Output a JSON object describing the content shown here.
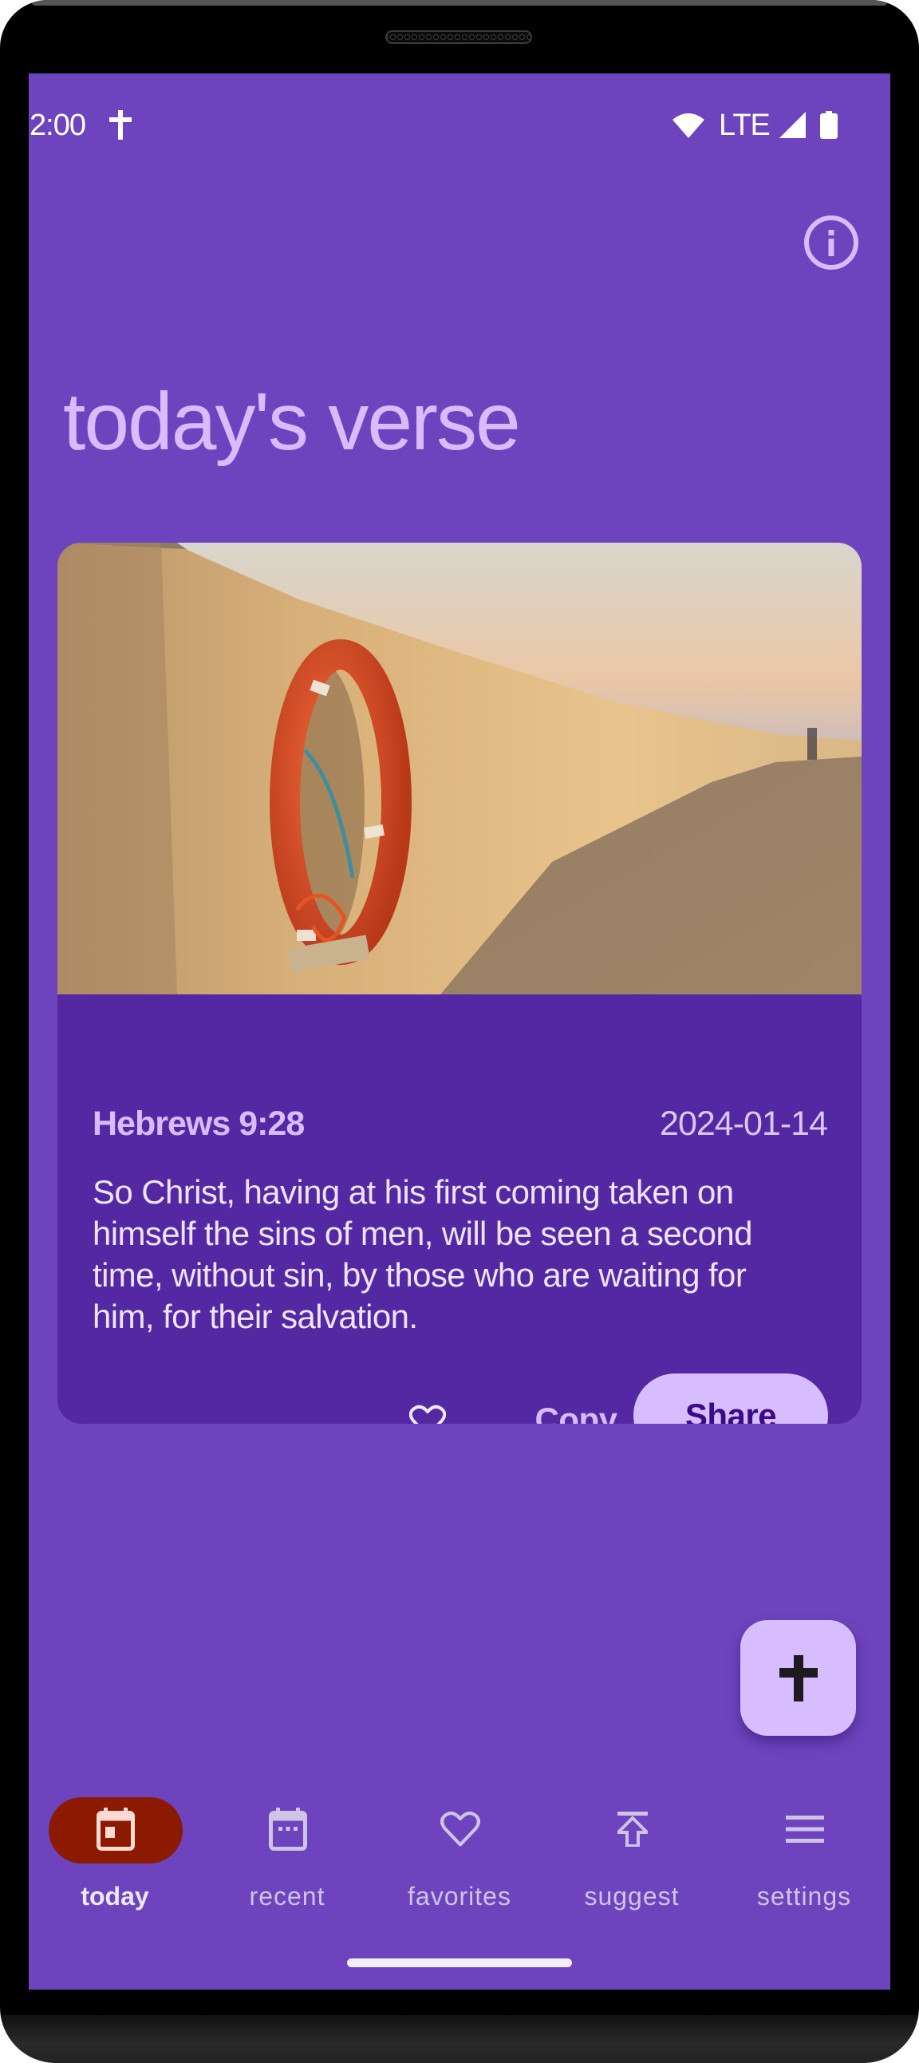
{
  "status_bar": {
    "time": "2:00",
    "notification_icon": "cross-icon",
    "network_label": "LTE",
    "icons": [
      "wifi-icon",
      "signal-icon",
      "battery-icon"
    ]
  },
  "header": {
    "info_icon": "info-icon",
    "title": "today's verse"
  },
  "verse_card": {
    "image_alt": "Orange life ring hanging on a stone sea wall at sunset",
    "reference": "Hebrews 9:28",
    "date": "2024-01-14",
    "text_lines": [
      "So Christ, having at his first coming taken on",
      "himself the sins of men, will be seen a second",
      "time, without sin, by those who are waiting for",
      "him, for their salvation."
    ],
    "favorite_icon": "heart-outline-icon",
    "copy_label": "Copy",
    "share_label": "Share"
  },
  "fab": {
    "icon": "cross-icon"
  },
  "bottom_nav": {
    "active_index": 0,
    "items": [
      {
        "label": "today",
        "icon": "calendar-today-icon"
      },
      {
        "label": "recent",
        "icon": "calendar-icon"
      },
      {
        "label": "favorites",
        "icon": "heart-outline-icon"
      },
      {
        "label": "suggest",
        "icon": "upload-icon"
      },
      {
        "label": "settings",
        "icon": "menu-icon"
      }
    ]
  },
  "colors": {
    "background": "#6D44BE",
    "card": "#5428A3",
    "accent_light": "#D9BBFF",
    "share_button": "#D7BCFF",
    "share_text": "#3B0A87",
    "nav_active_pill": "#8B1A00"
  }
}
